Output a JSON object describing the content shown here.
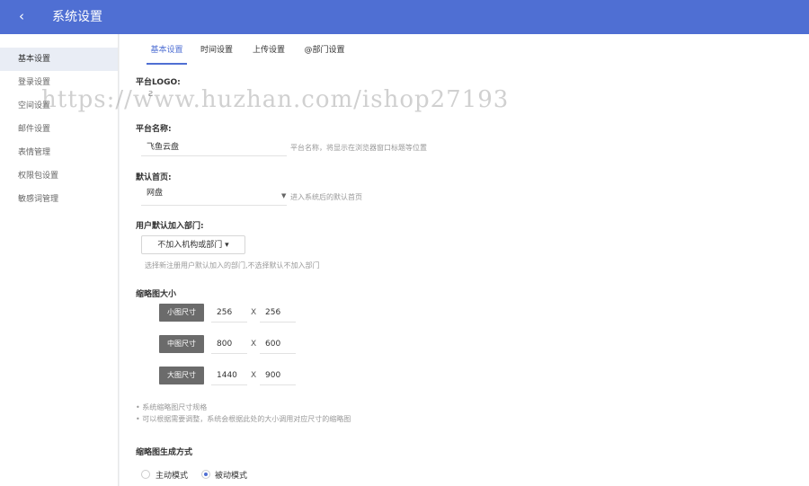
{
  "header": {
    "back_icon": "chevron-left-icon",
    "title": "系统设置"
  },
  "sidebar": {
    "items": [
      {
        "label": "基本设置",
        "active": true
      },
      {
        "label": "登录设置"
      },
      {
        "label": "空间设置"
      },
      {
        "label": "邮件设置"
      },
      {
        "label": "表情管理"
      },
      {
        "label": "权限包设置"
      },
      {
        "label": "敏感词管理"
      }
    ]
  },
  "tabs": [
    {
      "label": "基本设置",
      "active": true
    },
    {
      "label": "时间设置"
    },
    {
      "label": "上传设置"
    },
    {
      "label": "@部门设置"
    }
  ],
  "form": {
    "logo_label": "平台LOGO:",
    "logo_placeholder": "Ƨ",
    "name_label": "平台名称:",
    "name_value": "飞鱼云盘",
    "name_hint": "平台名称，将显示在浏览器窗口标题等位置",
    "home_label": "默认首页:",
    "home_value": "网盘",
    "home_hint": "进入系统后的默认首页",
    "dept_label": "用户默认加入部门:",
    "dept_button": "不加入机构或部门 ▾",
    "dept_hint": "选择新注册用户默认加入的部门,不选择默认不加入部门",
    "thumb_label": "缩略图大小",
    "sizes": [
      {
        "tag": "小图尺寸",
        "w": "256",
        "h": "256"
      },
      {
        "tag": "中图尺寸",
        "w": "800",
        "h": "600"
      },
      {
        "tag": "大图尺寸",
        "w": "1440",
        "h": "900"
      }
    ],
    "x_sep": "X",
    "notes": [
      "• 系统缩略图尺寸规格",
      "• 可以根据需要调整，系统会根据此处的大小调用对应尺寸的缩略图"
    ],
    "gen_label": "缩略图生成方式",
    "gen_options": [
      {
        "label": "主动模式",
        "checked": false
      },
      {
        "label": "被动模式",
        "checked": true
      }
    ]
  },
  "watermark": "https://www.huzhan.com/ishop27193"
}
